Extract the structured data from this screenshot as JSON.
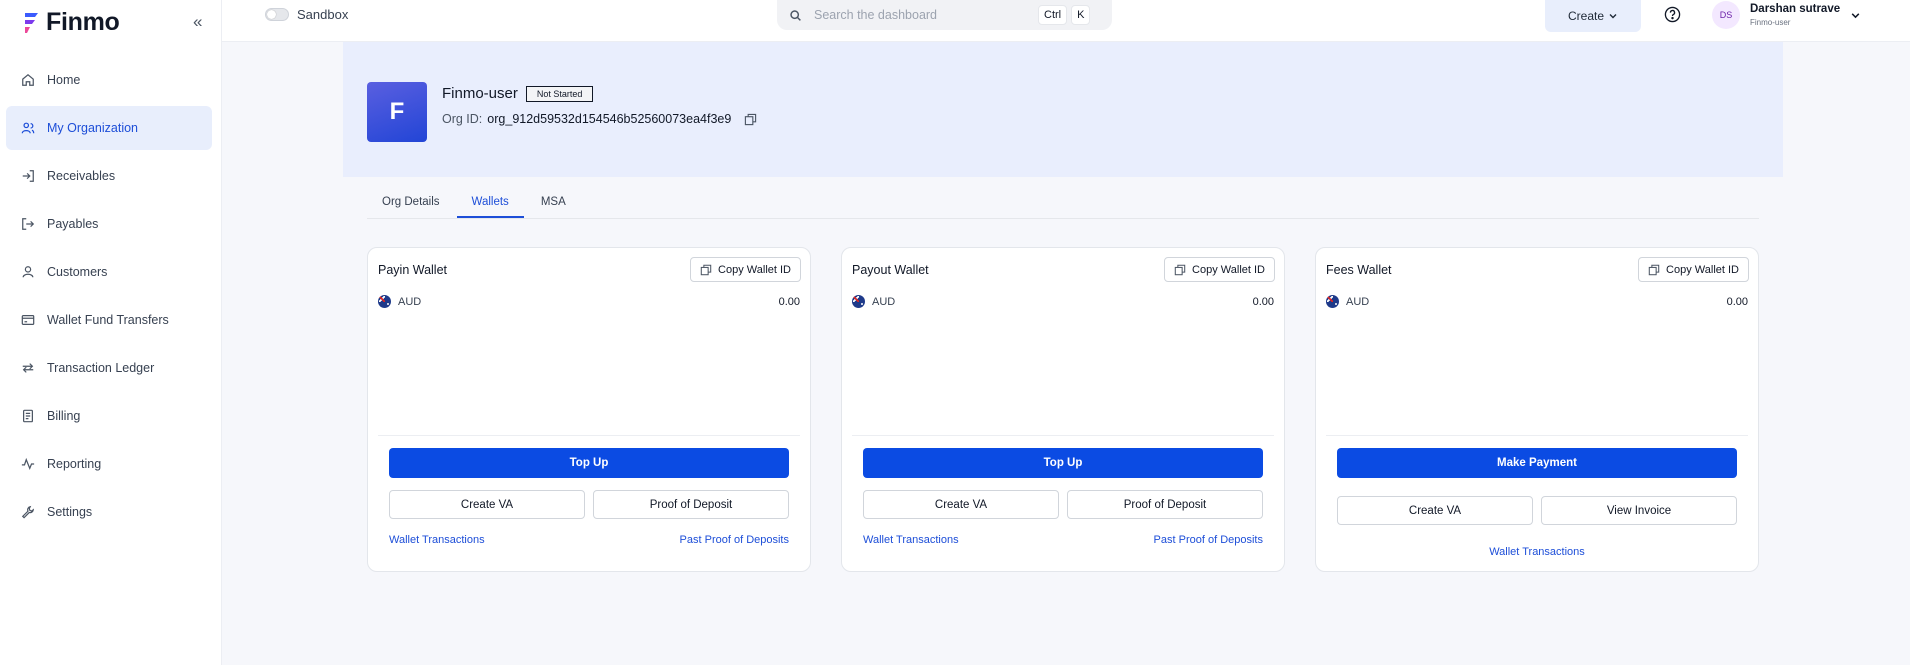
{
  "app": {
    "logo_text": "Finmo",
    "collapse_glyph": "«"
  },
  "sidebar": {
    "items": [
      {
        "label": "Home",
        "icon": "home-icon"
      },
      {
        "label": "My Organization",
        "icon": "users-icon",
        "active": true
      },
      {
        "label": "Receivables",
        "icon": "arrow-in-icon"
      },
      {
        "label": "Payables",
        "icon": "arrow-out-icon"
      },
      {
        "label": "Customers",
        "icon": "user-icon"
      },
      {
        "label": "Wallet Fund Transfers",
        "icon": "wallet-icon"
      },
      {
        "label": "Transaction Ledger",
        "icon": "repeat-icon"
      },
      {
        "label": "Billing",
        "icon": "receipt-icon"
      },
      {
        "label": "Reporting",
        "icon": "activity-icon"
      },
      {
        "label": "Settings",
        "icon": "wrench-icon"
      }
    ]
  },
  "topbar": {
    "sandbox_label": "Sandbox",
    "search_placeholder": "Search the dashboard",
    "shortcut_key1": "Ctrl",
    "shortcut_key2": "K",
    "create_label": "Create",
    "user": {
      "initials": "DS",
      "name": "Darshan sutrave",
      "org": "Finmo-user"
    }
  },
  "org": {
    "avatar_letter": "F",
    "name": "Finmo-user",
    "status": "Not Started",
    "id_label": "Org ID:",
    "id_value": "org_912d59532d154546b52560073ea4f3e9"
  },
  "tabs": [
    {
      "label": "Org Details"
    },
    {
      "label": "Wallets",
      "active": true
    },
    {
      "label": "MSA"
    }
  ],
  "wallets": [
    {
      "title": "Payin Wallet",
      "copy_label": "Copy Wallet ID",
      "currency": "AUD",
      "amount": "0.00",
      "primary_label": "Top Up",
      "secondary": [
        "Create VA",
        "Proof of Deposit"
      ],
      "link_left": "Wallet Transactions",
      "link_right": "Past Proof of Deposits"
    },
    {
      "title": "Payout Wallet",
      "copy_label": "Copy Wallet ID",
      "currency": "AUD",
      "amount": "0.00",
      "primary_label": "Top Up",
      "secondary": [
        "Create VA",
        "Proof of Deposit"
      ],
      "link_left": "Wallet Transactions",
      "link_right": "Past Proof of Deposits"
    },
    {
      "title": "Fees Wallet",
      "copy_label": "Copy Wallet ID",
      "currency": "AUD",
      "amount": "0.00",
      "primary_label": "Make Payment",
      "secondary": [
        "Create VA",
        "View Invoice"
      ],
      "link_center": "Wallet Transactions"
    }
  ],
  "colors": {
    "accent": "#0b4be3",
    "link": "#1d4ed8",
    "banner": "#e9eefd",
    "active_nav": "#e8eefc"
  }
}
